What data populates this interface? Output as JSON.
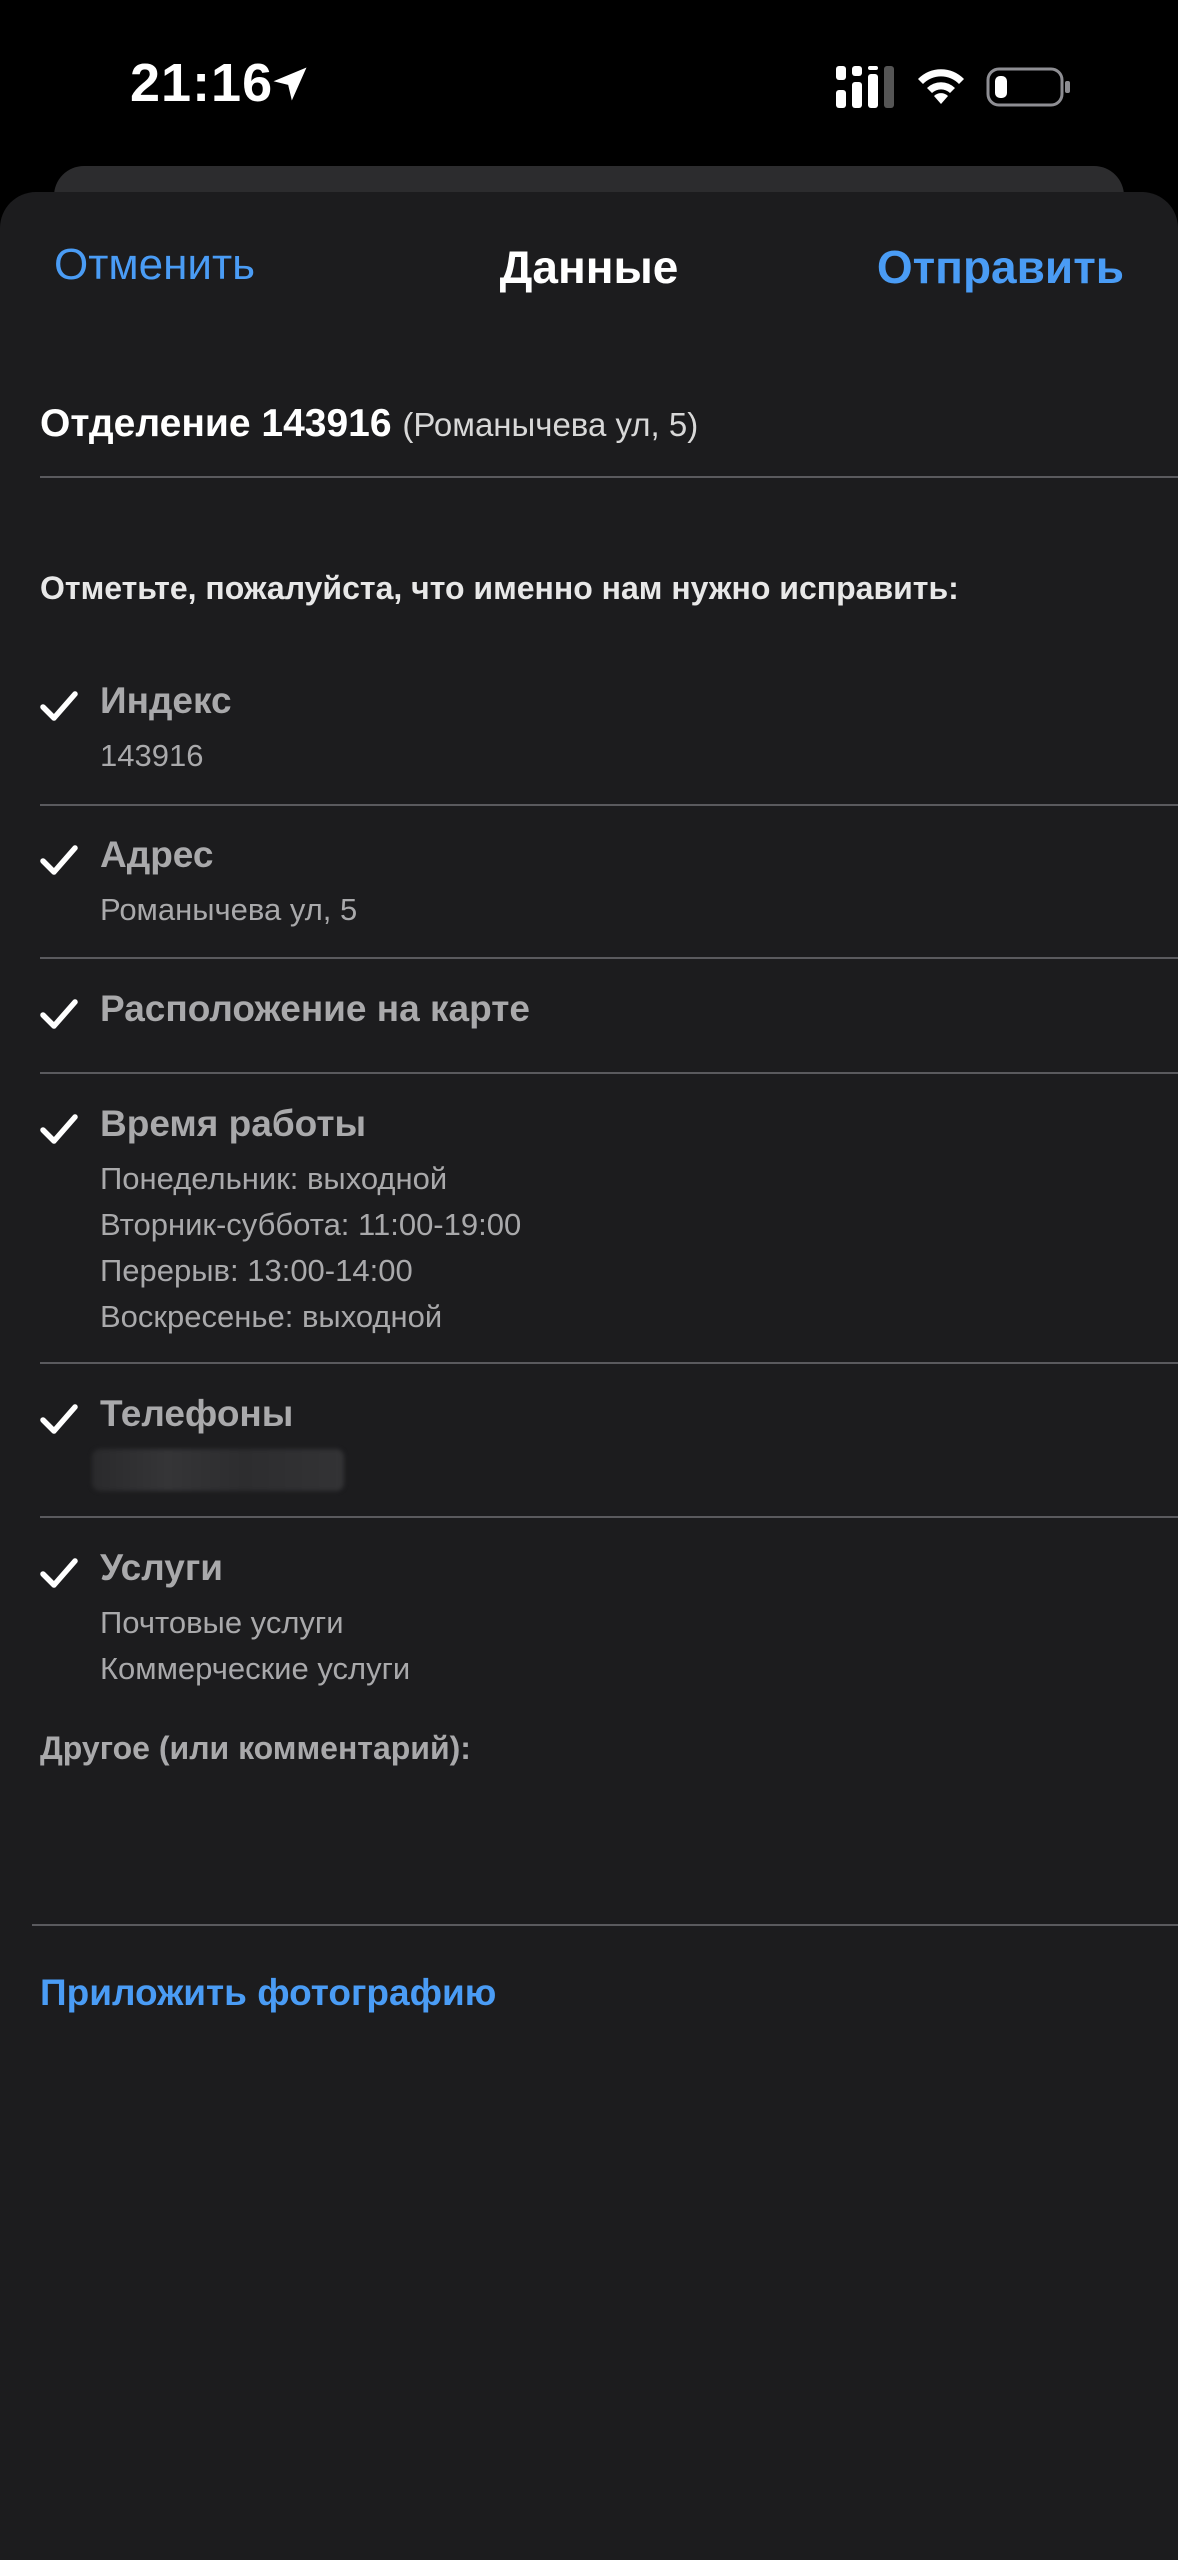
{
  "status_bar": {
    "time": "21:16",
    "icons": [
      "location-arrow-icon",
      "cellular-signal-icon",
      "wifi-icon",
      "battery-low-icon"
    ]
  },
  "nav": {
    "cancel_label": "Отменить",
    "title": "Данные",
    "send_label": "Отправить"
  },
  "office": {
    "name": "Отделение 143916",
    "address": "(Романычева ул, 5)"
  },
  "prompt": "Отметьте, пожалуйста, что именно нам нужно исправить:",
  "items": [
    {
      "title": "Индекс",
      "lines": [
        "143916"
      ],
      "checked": true
    },
    {
      "title": "Адрес",
      "lines": [
        "Романычева ул, 5"
      ],
      "checked": true
    },
    {
      "title": "Расположение на карте",
      "lines": [],
      "checked": true
    },
    {
      "title": "Время работы",
      "lines": [
        "Понедельник: выходной",
        "Вторник-суббота: 11:00-19:00",
        "Перерыв: 13:00-14:00",
        "Воскресенье: выходной"
      ],
      "checked": true
    },
    {
      "title": "Телефоны",
      "lines": [],
      "checked": true
    },
    {
      "title": "Услуги",
      "lines": [
        "Почтовые услуги",
        "Коммерческие услуги"
      ],
      "checked": true
    }
  ],
  "other_label": "Другое (или комментарий):",
  "attach_label": "Приложить фотографию",
  "colors": {
    "accent": "#4a9cf5",
    "sheet_background": "#1c1c1e",
    "muted_text": "#a9a9ab"
  }
}
